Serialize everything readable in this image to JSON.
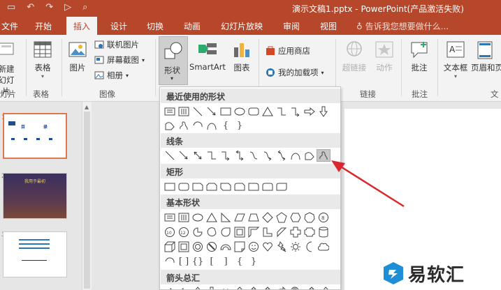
{
  "window": {
    "title": "演示文稿1.pptx - PowerPoint(产品激活失败)"
  },
  "tabs": [
    {
      "label": "文件"
    },
    {
      "label": "开始"
    },
    {
      "label": "插入"
    },
    {
      "label": "设计"
    },
    {
      "label": "切换"
    },
    {
      "label": "动画"
    },
    {
      "label": "幻灯片放映"
    },
    {
      "label": "审阅"
    },
    {
      "label": "视图"
    }
  ],
  "tell_me": "告诉我您想要做什么...",
  "ribbon": {
    "new_slide": "新建\n幻灯片",
    "table": "表格",
    "picture": "图片",
    "online_picture": "联机图片",
    "screenshot": "屏幕截图",
    "album": "相册",
    "shapes": "形状",
    "smartart": "SmartArt",
    "chart": "图表",
    "store": "应用商店",
    "my_addins": "我的加载项",
    "hyperlink": "超链接",
    "action": "动作",
    "comment": "批注",
    "textbox": "文本框",
    "header_footer": "页眉和页",
    "groups": {
      "slides": "灯片",
      "tables": "表格",
      "images": "图像",
      "links": "链接",
      "comments": "批注",
      "text": "文"
    }
  },
  "gallery": {
    "recent": "最近使用的形状",
    "lines": "线条",
    "rectangles": "矩形",
    "basic": "基本形状",
    "block_arrows": "箭头总汇"
  },
  "slides": [
    {
      "number": "1"
    },
    {
      "number": "2"
    },
    {
      "number": "3"
    }
  ],
  "thumb_text": {
    "s1_a": "目",
    "s1_b": "录",
    "s2": "我用于最初"
  },
  "watermark": {
    "text": "易软汇"
  },
  "colors": {
    "accent": "#b7472a",
    "arrow": "#d9272e"
  }
}
